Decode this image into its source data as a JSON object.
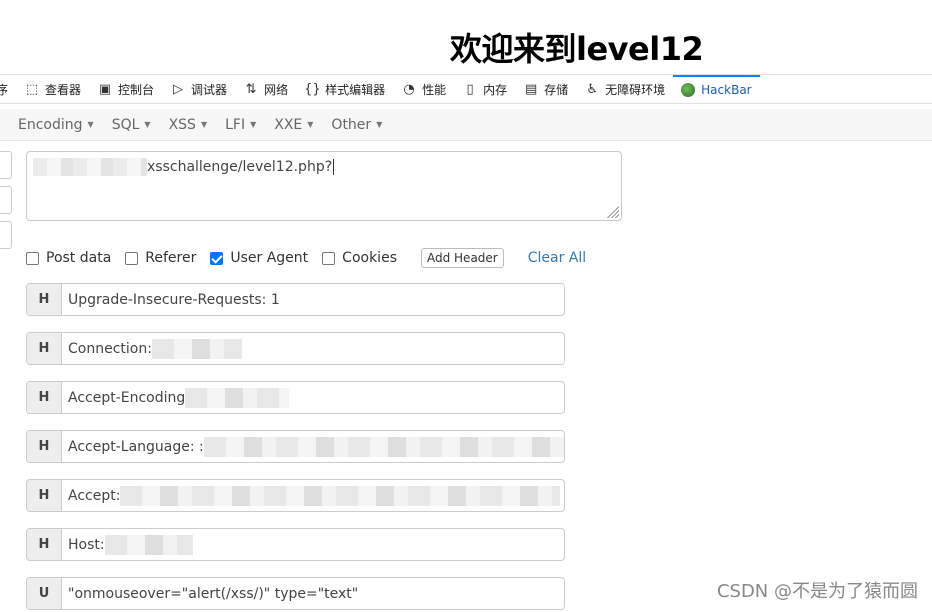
{
  "page": {
    "title": "欢迎来到level12"
  },
  "devtools": {
    "tabs": [
      {
        "label": "序",
        "icon": ""
      },
      {
        "label": "查看器",
        "icon": "⬚"
      },
      {
        "label": "控制台",
        "icon": "▣"
      },
      {
        "label": "调试器",
        "icon": "▷"
      },
      {
        "label": "网络",
        "icon": "⇅"
      },
      {
        "label": "样式编辑器",
        "icon": "{}"
      },
      {
        "label": "性能",
        "icon": "◔"
      },
      {
        "label": "内存",
        "icon": "▯"
      },
      {
        "label": "存储",
        "icon": "▤"
      },
      {
        "label": "无障碍环境",
        "icon": "♿"
      },
      {
        "label": "HackBar",
        "icon": "hackbar-logo"
      }
    ]
  },
  "hackbar": {
    "menu": [
      "Encoding",
      "SQL",
      "XSS",
      "LFI",
      "XXE",
      "Other"
    ],
    "url_suffix": "xsschallenge/level12.php?",
    "options": {
      "post_data": {
        "label": "Post data",
        "checked": false
      },
      "referer": {
        "label": "Referer",
        "checked": false
      },
      "user_agent": {
        "label": "User Agent",
        "checked": true
      },
      "cookies": {
        "label": "Cookies",
        "checked": false
      }
    },
    "add_header_label": "Add Header",
    "clear_all_label": "Clear All",
    "headers": [
      {
        "key": "H",
        "value": "Upgrade-Insecure-Requests: 1",
        "redacted": false
      },
      {
        "key": "H",
        "value": "Connection:",
        "redacted": true
      },
      {
        "key": "H",
        "value": "Accept-Encoding",
        "redacted": true
      },
      {
        "key": "H",
        "value": "Accept-Language: :",
        "redacted": true
      },
      {
        "key": "H",
        "value": "Accept:",
        "redacted": true
      },
      {
        "key": "H",
        "value": "Host:",
        "redacted": true
      },
      {
        "key": "U",
        "value": "\"onmouseover=\"alert(/xss/)\" type=\"text\"",
        "redacted": false
      }
    ]
  },
  "watermark": "CSDN @不是为了猿而圆"
}
